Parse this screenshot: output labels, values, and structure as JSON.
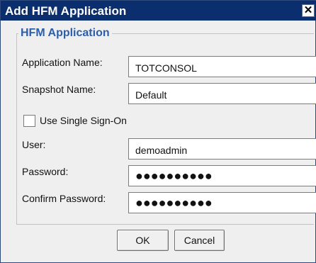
{
  "window": {
    "title": "Add HFM Application",
    "close_glyph": "✕"
  },
  "group": {
    "title": "HFM Application"
  },
  "form": {
    "application_name": {
      "label": "Application Name:",
      "value": "TOTCONSOL"
    },
    "snapshot_name": {
      "label": "Snapshot Name:",
      "value": "Default"
    },
    "single_sign_on": {
      "label": "Use Single Sign-On",
      "checked": false
    },
    "user": {
      "label": "User:",
      "value": "demoadmin"
    },
    "password": {
      "label": "Password:",
      "masked": "●●●●●●●●●●"
    },
    "confirm_password": {
      "label": "Confirm Password:",
      "masked": "●●●●●●●●●●"
    }
  },
  "buttons": {
    "ok_label": "OK",
    "cancel_label": "Cancel"
  }
}
